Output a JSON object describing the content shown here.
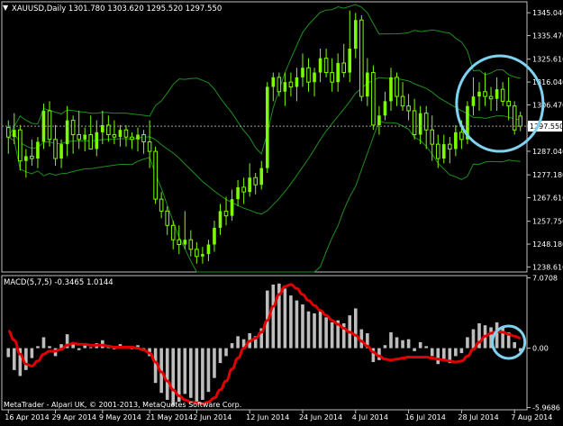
{
  "colors": {
    "background": "#000000",
    "candle": "#7CFC00",
    "bollinger": "#1E8E1E",
    "axis": "#BFBFBF",
    "text": "#FFFFFF",
    "price_line": "#A0A0A0",
    "price_label_bg": "#FFFFFF",
    "price_label_text": "#000000",
    "histogram": "#BDBDBD",
    "signal": "#E00000",
    "highlight_circle": "#7FD3F0"
  },
  "chart_data": [
    {
      "type": "candlestick",
      "title": "XAUUSD,Daily  1301.780 1303.620 1295.520 1297.550",
      "symbol": "XAUUSD",
      "timeframe": "Daily",
      "ohlc_header": [
        1301.78,
        1303.62,
        1295.52,
        1297.55
      ],
      "ylim": [
        1236.5,
        1348.5
      ],
      "yticks": [
        "1345.040",
        "1335.470",
        "1325.610",
        "1316.040",
        "1306.470",
        "1297.550",
        "1287.040",
        "1277.180",
        "1267.610",
        "1257.750",
        "1248.180",
        "1238.610"
      ],
      "current_price": "1297.550",
      "candles": [
        [
          1297,
          1300,
          1286,
          1293
        ],
        [
          1293,
          1303,
          1290,
          1296
        ],
        [
          1296,
          1298,
          1279,
          1283
        ],
        [
          1283,
          1288,
          1276,
          1285
        ],
        [
          1285,
          1292,
          1281,
          1284
        ],
        [
          1284,
          1293,
          1280,
          1291
        ],
        [
          1291,
          1307,
          1288,
          1304
        ],
        [
          1304,
          1308,
          1289,
          1292
        ],
        [
          1292,
          1298,
          1281,
          1284
        ],
        [
          1284,
          1292,
          1280,
          1290
        ],
        [
          1290,
          1306,
          1285,
          1300
        ],
        [
          1300,
          1302,
          1286,
          1294
        ],
        [
          1294,
          1304,
          1288,
          1292
        ],
        [
          1292,
          1297,
          1287,
          1294
        ],
        [
          1294,
          1302,
          1291,
          1288
        ],
        [
          1288,
          1300,
          1285,
          1295
        ],
        [
          1295,
          1304,
          1290,
          1298
        ],
        [
          1298,
          1302,
          1291,
          1294
        ],
        [
          1294,
          1300,
          1290,
          1293
        ],
        [
          1293,
          1298,
          1289,
          1296
        ],
        [
          1296,
          1298,
          1289,
          1293
        ],
        [
          1293,
          1295,
          1288,
          1292
        ],
        [
          1292,
          1297,
          1287,
          1294
        ],
        [
          1294,
          1296,
          1286,
          1291
        ],
        [
          1291,
          1300,
          1280,
          1287
        ],
        [
          1287,
          1289,
          1265,
          1267
        ],
        [
          1267,
          1270,
          1259,
          1262
        ],
        [
          1262,
          1264,
          1252,
          1256
        ],
        [
          1256,
          1258,
          1246,
          1250
        ],
        [
          1250,
          1256,
          1244,
          1248
        ],
        [
          1248,
          1262,
          1246,
          1250
        ],
        [
          1250,
          1254,
          1243,
          1246
        ],
        [
          1246,
          1249,
          1240,
          1243
        ],
        [
          1243,
          1247,
          1240,
          1244
        ],
        [
          1244,
          1250,
          1241,
          1248
        ],
        [
          1248,
          1258,
          1245,
          1255
        ],
        [
          1255,
          1265,
          1252,
          1262
        ],
        [
          1262,
          1268,
          1256,
          1260
        ],
        [
          1260,
          1271,
          1258,
          1267
        ],
        [
          1267,
          1275,
          1264,
          1272
        ],
        [
          1272,
          1276,
          1265,
          1270
        ],
        [
          1270,
          1282,
          1268,
          1276
        ],
        [
          1276,
          1278,
          1269,
          1273
        ],
        [
          1273,
          1283,
          1271,
          1280
        ],
        [
          1280,
          1316,
          1278,
          1314
        ],
        [
          1314,
          1320,
          1308,
          1318
        ],
        [
          1318,
          1320,
          1310,
          1312
        ],
        [
          1312,
          1320,
          1306,
          1316
        ],
        [
          1316,
          1320,
          1310,
          1314
        ],
        [
          1314,
          1322,
          1308,
          1318
        ],
        [
          1318,
          1328,
          1314,
          1322
        ],
        [
          1322,
          1326,
          1312,
          1316
        ],
        [
          1316,
          1322,
          1310,
          1320
        ],
        [
          1320,
          1330,
          1316,
          1326
        ],
        [
          1326,
          1330,
          1318,
          1320
        ],
        [
          1320,
          1326,
          1312,
          1316
        ],
        [
          1316,
          1328,
          1312,
          1324
        ],
        [
          1324,
          1332,
          1318,
          1320
        ],
        [
          1320,
          1346,
          1316,
          1330
        ],
        [
          1330,
          1345,
          1326,
          1342
        ],
        [
          1342,
          1344,
          1308,
          1310
        ],
        [
          1310,
          1326,
          1306,
          1320
        ],
        [
          1320,
          1323,
          1296,
          1298
        ],
        [
          1298,
          1306,
          1294,
          1302
        ],
        [
          1302,
          1312,
          1300,
          1308
        ],
        [
          1308,
          1322,
          1304,
          1318
        ],
        [
          1318,
          1320,
          1306,
          1310
        ],
        [
          1310,
          1316,
          1304,
          1306
        ],
        [
          1306,
          1311,
          1300,
          1304
        ],
        [
          1304,
          1309,
          1292,
          1294
        ],
        [
          1294,
          1306,
          1290,
          1303
        ],
        [
          1303,
          1306,
          1288,
          1296
        ],
        [
          1296,
          1302,
          1283,
          1290
        ],
        [
          1290,
          1294,
          1280,
          1284
        ],
        [
          1284,
          1294,
          1282,
          1290
        ],
        [
          1290,
          1293,
          1282,
          1288
        ],
        [
          1288,
          1298,
          1285,
          1295
        ],
        [
          1295,
          1300,
          1288,
          1292
        ],
        [
          1292,
          1308,
          1290,
          1306
        ],
        [
          1306,
          1318,
          1302,
          1310
        ],
        [
          1310,
          1316,
          1304,
          1312
        ],
        [
          1312,
          1320,
          1306,
          1310
        ],
        [
          1310,
          1314,
          1304,
          1309
        ],
        [
          1309,
          1318,
          1304,
          1313
        ],
        [
          1313,
          1316,
          1306,
          1308
        ],
        [
          1308,
          1318,
          1300,
          1306
        ],
        [
          1306,
          1308,
          1294,
          1296
        ],
        [
          1301.78,
          1303.62,
          1295.52,
          1297.55
        ]
      ]
    },
    {
      "type": "macd",
      "title": "MACD(5,7,5) -0.3465 1.0144",
      "params": [
        5,
        7,
        5
      ],
      "macd_value": -0.3465,
      "signal_value": 1.0144,
      "ylim": [
        -6.2,
        7.3
      ],
      "yticks": [
        "7.0708",
        "0.00",
        "-5.9686"
      ],
      "histogram": [
        -0.9,
        -2.2,
        -2.8,
        -2.2,
        -1.0,
        0.2,
        1.1,
        0.2,
        -0.8,
        0.4,
        1.4,
        0.6,
        -0.2,
        0.4,
        0.1,
        0.5,
        0.8,
        0.3,
        -0.1,
        0.4,
        0.2,
        0.0,
        0.3,
        -0.1,
        -0.8,
        -3.5,
        -4.5,
        -5.2,
        -5.8,
        -5.4,
        -4.6,
        -5.0,
        -5.6,
        -5.2,
        -4.4,
        -3.0,
        -1.5,
        -0.8,
        0.5,
        1.2,
        0.9,
        1.5,
        1.2,
        2.0,
        5.8,
        6.4,
        6.5,
        6.0,
        5.3,
        4.8,
        4.4,
        3.7,
        3.5,
        3.9,
        3.1,
        2.6,
        2.8,
        2.5,
        3.3,
        4.0,
        1.9,
        1.5,
        -1.4,
        -1.2,
        0.3,
        1.6,
        1.1,
        0.8,
        0.9,
        -0.3,
        0.6,
        0.2,
        -0.8,
        -1.6,
        -1.2,
        -1.5,
        -0.8,
        -0.5,
        1.1,
        1.9,
        2.5,
        2.3,
        2.1,
        2.6,
        2.1,
        1.6,
        0.6,
        -0.35
      ],
      "signal": [
        1.7,
        0.8,
        -0.6,
        -1.6,
        -1.8,
        -1.3,
        -0.6,
        -0.3,
        -0.3,
        -0.1,
        0.3,
        0.5,
        0.4,
        0.4,
        0.3,
        0.3,
        0.3,
        0.2,
        0.1,
        0.1,
        0.1,
        0.1,
        0.0,
        -0.2,
        -0.5,
        -1.4,
        -2.4,
        -3.3,
        -4.2,
        -4.8,
        -5.2,
        -5.4,
        -5.5,
        -5.6,
        -5.4,
        -5.0,
        -4.2,
        -3.3,
        -2.1,
        -1.0,
        0.0,
        0.7,
        1.0,
        1.6,
        2.8,
        4.2,
        5.4,
        6.2,
        6.4,
        6.0,
        5.4,
        4.8,
        4.3,
        3.8,
        3.3,
        2.8,
        2.4,
        2.0,
        1.6,
        1.3,
        0.7,
        0.2,
        -0.4,
        -0.8,
        -1.1,
        -1.2,
        -1.1,
        -1.0,
        -0.9,
        -0.9,
        -0.9,
        -0.9,
        -1.0,
        -1.1,
        -1.2,
        -1.3,
        -1.4,
        -1.3,
        -0.8,
        -0.1,
        0.6,
        1.2,
        1.5,
        1.7,
        1.6,
        1.4,
        1.2,
        1.01
      ]
    }
  ],
  "x_labels": [
    "16 Apr 2014",
    "29 Apr 2014",
    "9 May 2014",
    "21 May 2014",
    "2 Jun 2014",
    "12 Jun 2014",
    "24 Jun 2014",
    "4 Jul 2014",
    "16 Jul 2014",
    "28 Jul 2014",
    "7 Aug 2014"
  ],
  "x_label_index": [
    0,
    8,
    16,
    24,
    32,
    41,
    50,
    59,
    68,
    77,
    86
  ],
  "copyright": "MetaTrader - Alpari UK, © 2001-2013, MetaQuotes Software Corp.",
  "menu_marker": "▼"
}
